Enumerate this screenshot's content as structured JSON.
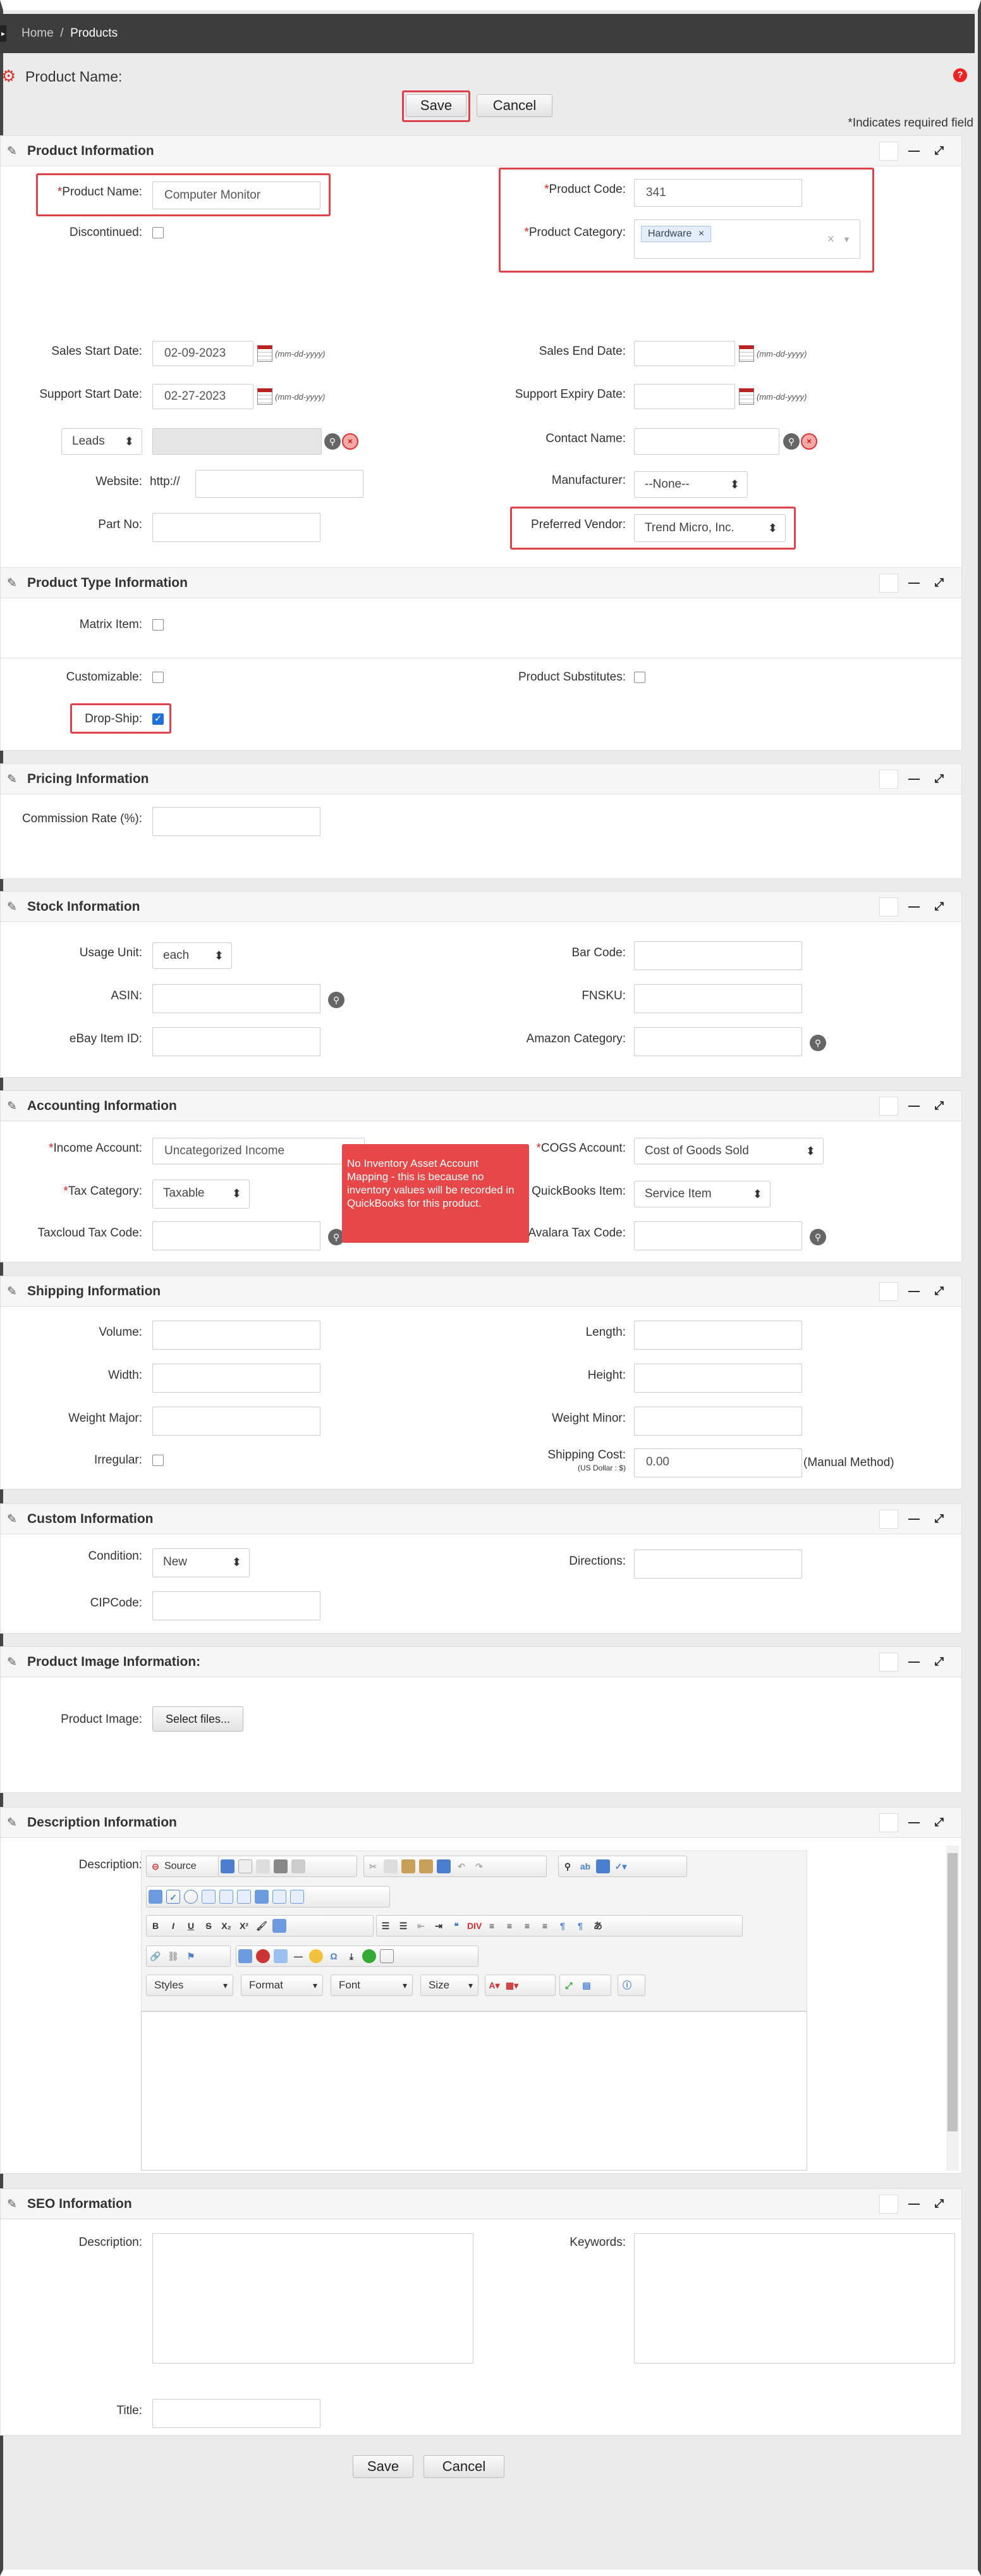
{
  "breadcrumb": {
    "home": "Home",
    "sep": "/",
    "current": "Products"
  },
  "page": {
    "title": "Product Name:",
    "required_note": "*Indicates required field",
    "save": "Save",
    "cancel": "Cancel"
  },
  "product_info": {
    "title": "Product Information",
    "product_name_label": "Product Name:",
    "product_name": "Computer Monitor",
    "product_code_label": "Product Code:",
    "product_code": "341",
    "discontinued_label": "Discontinued:",
    "category_label": "Product Category:",
    "category_tag": "Hardware",
    "sales_start_label": "Sales Start Date:",
    "sales_start": "02-09-2023",
    "sales_end_label": "Sales End Date:",
    "support_start_label": "Support Start Date:",
    "support_start": "02-27-2023",
    "support_expiry_label": "Support Expiry Date:",
    "date_format": "(mm-dd-yyyy)",
    "related_select": "Leads",
    "contact_label": "Contact Name:",
    "website_label": "Website:",
    "website_prefix": "http://",
    "manufacturer_label": "Manufacturer:",
    "manufacturer": "--None--",
    "part_no_label": "Part No:",
    "vendor_label": "Preferred Vendor:",
    "vendor": "Trend Micro, Inc."
  },
  "type_info": {
    "title": "Product Type Information",
    "matrix_label": "Matrix Item:",
    "customizable_label": "Customizable:",
    "substitutes_label": "Product Substitutes:",
    "dropship_label": "Drop-Ship:"
  },
  "pricing": {
    "title": "Pricing Information",
    "commission_label": "Commission Rate (%):"
  },
  "stock": {
    "title": "Stock Information",
    "usage_unit_label": "Usage Unit:",
    "usage_unit": "each",
    "barcode_label": "Bar Code:",
    "asin_label": "ASIN:",
    "fnsku_label": "FNSKU:",
    "ebay_label": "eBay Item ID:",
    "amazon_label": "Amazon Category:"
  },
  "accounting": {
    "title": "Accounting Information",
    "income_label": "Income Account:",
    "income": "Uncategorized Income",
    "cogs_label": "COGS Account:",
    "cogs": "Cost of Goods Sold",
    "tax_cat_label": "Tax Category:",
    "tax_cat": "Taxable",
    "qb_item_label": "QuickBooks Item:",
    "qb_item": "Service Item",
    "taxcloud_label": "Taxcloud Tax Code:",
    "avalara_label": "Avalara Tax Code:",
    "tooltip": "No Inventory Asset Account Mapping - this is because no inventory values will be recorded in QuickBooks for this product."
  },
  "shipping": {
    "title": "Shipping Information",
    "volume_label": "Volume:",
    "length_label": "Length:",
    "width_label": "Width:",
    "height_label": "Height:",
    "wmajor_label": "Weight Major:",
    "wminor_label": "Weight Minor:",
    "irregular_label": "Irregular:",
    "cost_label": "Shipping Cost:",
    "cost_sub": "(US Dollar : $)",
    "cost": "0.00",
    "cost_note": "(Manual Method)"
  },
  "custom": {
    "title": "Custom Information",
    "condition_label": "Condition:",
    "condition": "New",
    "directions_label": "Directions:",
    "cipcode_label": "CIPCode:"
  },
  "image": {
    "title": "Product Image Information:",
    "label": "Product Image:",
    "button": "Select files..."
  },
  "description": {
    "title": "Description Information",
    "label": "Description:",
    "source": "Source",
    "styles": "Styles",
    "format": "Format",
    "font": "Font",
    "size": "Size"
  },
  "seo": {
    "title": "SEO Information",
    "desc_label": "Description:",
    "keywords_label": "Keywords:",
    "title_label": "Title:"
  },
  "colors": {
    "accent_red": "#e0404a",
    "topbar": "#3d3d3d",
    "checkbox_blue": "#1e6fd9"
  }
}
